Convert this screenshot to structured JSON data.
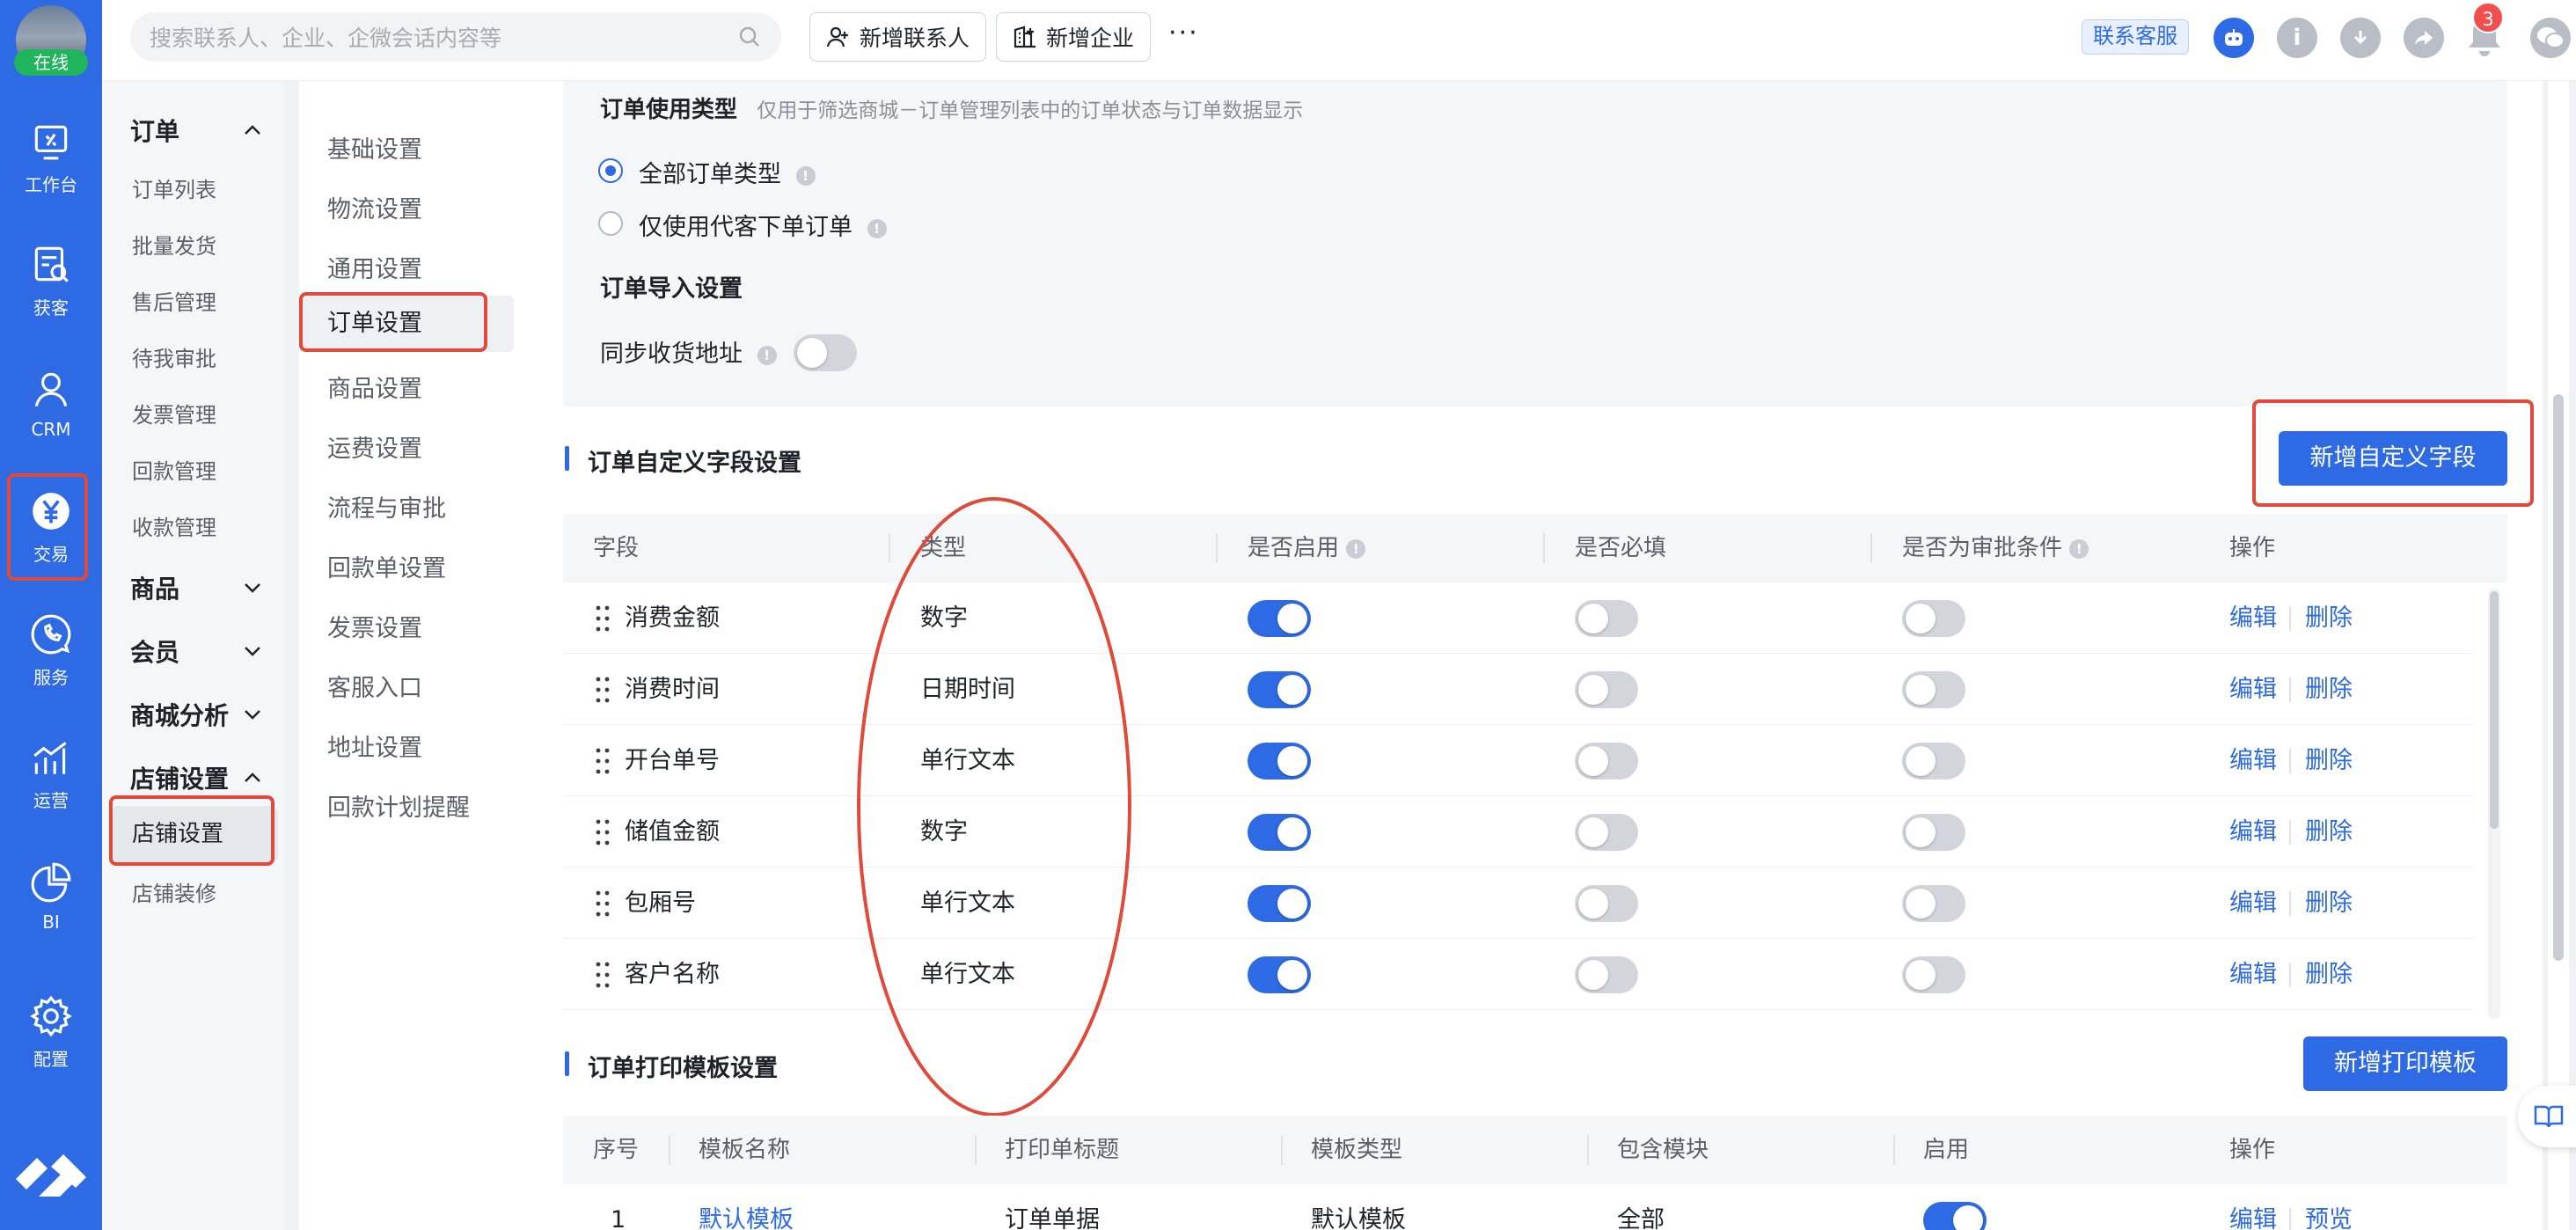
{
  "user": {
    "status": "在线"
  },
  "rail": [
    {
      "label": "工作台",
      "icon": "workbench-icon"
    },
    {
      "label": "获客",
      "icon": "acquire-icon"
    },
    {
      "label": "CRM",
      "icon": "person-icon"
    },
    {
      "label": "交易",
      "icon": "yuan-icon"
    },
    {
      "label": "服务",
      "icon": "phone-chat-icon"
    },
    {
      "label": "运营",
      "icon": "chart-bars-icon"
    },
    {
      "label": "BI",
      "icon": "pie-icon"
    },
    {
      "label": "配置",
      "icon": "gear-icon"
    }
  ],
  "topbar": {
    "search_placeholder": "搜索联系人、企业、企微会话内容等",
    "new_contact": "新增联系人",
    "new_company": "新增企业",
    "more": "···",
    "support": "联系客服",
    "notify_count": "3"
  },
  "nav2": {
    "order_group": "订单",
    "order_items": [
      "订单列表",
      "批量发货",
      "售后管理",
      "待我审批",
      "发票管理",
      "回款管理",
      "收款管理"
    ],
    "goods_group": "商品",
    "member_group": "会员",
    "mall_group": "商城分析",
    "shop_group": "店铺设置",
    "shop_items": [
      "店铺设置",
      "店铺装修"
    ]
  },
  "nav3": [
    "基础设置",
    "物流设置",
    "通用设置",
    "订单设置",
    "商品设置",
    "运费设置",
    "流程与审批",
    "回款单设置",
    "发票设置",
    "客服入口",
    "地址设置",
    "回款计划提醒"
  ],
  "order_type": {
    "title": "订单使用类型",
    "hint": "仅用于筛选商城－订单管理列表中的订单状态与订单数据显示",
    "option_all": "全部订单类型",
    "option_proxy": "仅使用代客下单订单"
  },
  "order_import": {
    "title": "订单导入设置",
    "sync_label": "同步收货地址"
  },
  "custom_fields": {
    "title": "订单自定义字段设置",
    "add_button": "新增自定义字段",
    "headers": {
      "field": "字段",
      "type": "类型",
      "enabled": "是否启用",
      "required": "是否必填",
      "approval": "是否为审批条件",
      "ops": "操作"
    },
    "edit": "编辑",
    "delete": "删除",
    "rows": [
      {
        "name": "消费金额",
        "type": "数字"
      },
      {
        "name": "消费时间",
        "type": "日期时间"
      },
      {
        "name": "开台单号",
        "type": "单行文本"
      },
      {
        "name": "储值金额",
        "type": "数字"
      },
      {
        "name": "包厢号",
        "type": "单行文本"
      },
      {
        "name": "客户名称",
        "type": "单行文本"
      }
    ]
  },
  "print_templates": {
    "title": "订单打印模板设置",
    "add_button": "新增打印模板",
    "headers": {
      "no": "序号",
      "name": "模板名称",
      "print_title": "打印单标题",
      "tpl_type": "模板类型",
      "modules": "包含模块",
      "enabled": "启用",
      "ops": "操作"
    },
    "row": {
      "no": "1",
      "name": "默认模板",
      "print_title": "订单单据",
      "tpl_type": "默认模板",
      "modules": "全部",
      "edit": "编辑",
      "preview": "预览"
    }
  },
  "colors": {
    "primary": "#2d6ae3",
    "annotation": "#e04a3a",
    "online": "#20b45d"
  }
}
